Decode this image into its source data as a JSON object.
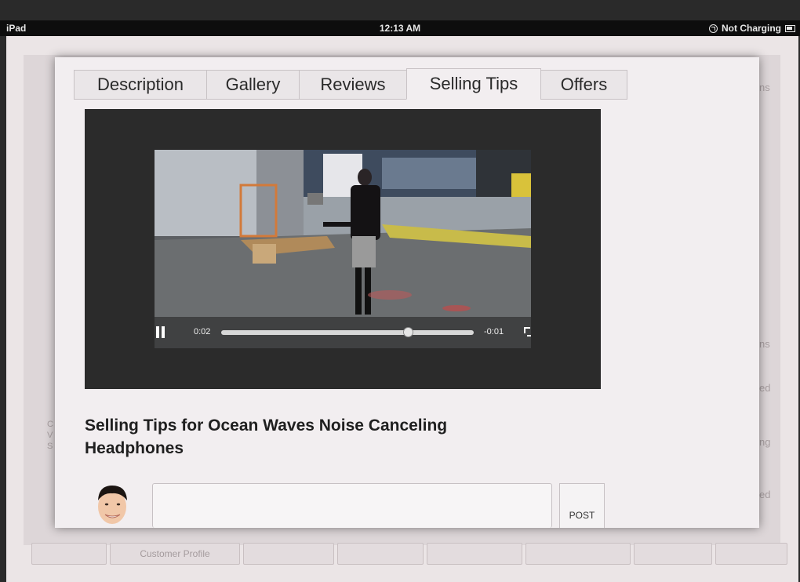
{
  "status_bar": {
    "device": "iPad",
    "time": "12:13 AM",
    "battery": "Not Charging"
  },
  "background_app": {
    "bottom_tab_visible": "Customer Profile",
    "fragments": [
      "ns",
      "ns",
      "ed",
      "ng",
      "ed",
      "C",
      "V",
      "S"
    ]
  },
  "modal": {
    "tabs": [
      {
        "label": "Description",
        "active": false
      },
      {
        "label": "Gallery",
        "active": false
      },
      {
        "label": "Reviews",
        "active": false
      },
      {
        "label": "Selling Tips",
        "active": true
      },
      {
        "label": "Offers",
        "active": false
      }
    ],
    "video": {
      "elapsed": "0:02",
      "remaining": "-0:01",
      "progress": 0.75,
      "state": "playing"
    },
    "heading": "Selling Tips for Ocean Waves Noise Canceling Headphones",
    "comment": {
      "placeholder": "",
      "post_label": "POST"
    }
  },
  "colors": {
    "modal_bg": "#f2eef0",
    "player_bg": "#2b2b2b",
    "status_bar": "#0d0d0d"
  }
}
